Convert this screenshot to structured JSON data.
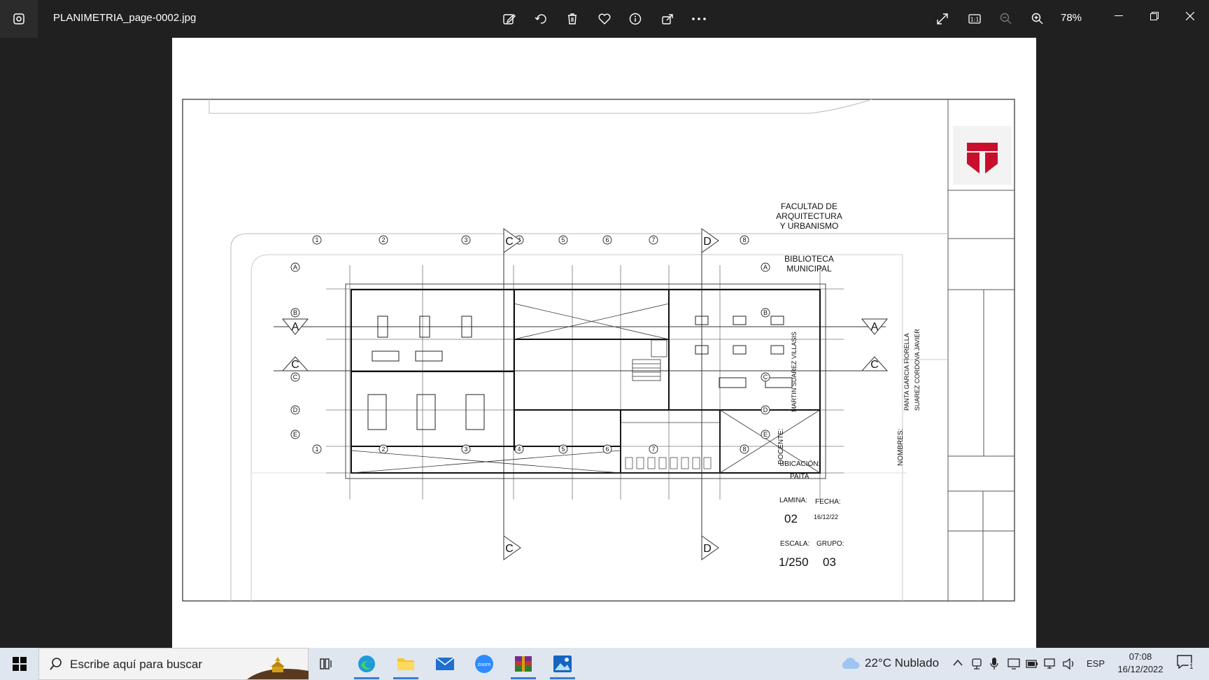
{
  "window": {
    "filename": "PLANIMETRIA_page-0002.jpg",
    "zoom": "78%"
  },
  "toolbar_icons": [
    "edit-icon",
    "rotate-icon",
    "delete-icon",
    "favorite-icon",
    "info-icon",
    "share-icon",
    "more-icon"
  ],
  "right_icons": [
    "fullscreen-icon",
    "actual-size-icon",
    "zoom-out-icon",
    "zoom-in-icon"
  ],
  "drawing": {
    "faculty": "FACULTAD DE\nARQUITECTURA\nY URBANISMO",
    "faculty_lines": [
      "FACULTAD DE",
      "ARQUITECTURA",
      "Y URBANISMO"
    ],
    "project_lines": [
      "BIBLIOTECA",
      "MUNICIPAL"
    ],
    "docente_label": "DOCENTE:",
    "docente_name": "MARTIN SUAREZ VILLASIS",
    "nombres_label": "NOMBRES:",
    "names": [
      "PANTA GARCIA FIORELLA",
      "SUAREZ CORDOVA JAVIER"
    ],
    "ubicacion_label": "UBICACIÓN:",
    "ubicacion": "PAITA",
    "lamina_label": "LAMINA:",
    "lamina": "02",
    "fecha_label": "FECHA:",
    "fecha": "16/12/22",
    "escala_label": "ESCALA:",
    "escala": "1/250",
    "grupo_label": "GRUPO:",
    "grupo": "03",
    "section_marks": [
      "A",
      "C",
      "D"
    ],
    "axis_numbers": [
      "1",
      "2",
      "3",
      "4",
      "5",
      "6",
      "7",
      "8"
    ],
    "axis_letters": [
      "A",
      "B",
      "C",
      "D",
      "E"
    ],
    "brand_color": "#c8102e"
  },
  "taskbar": {
    "search_placeholder": "Escribe aquí para buscar",
    "weather": "22°C  Nublado",
    "language": "ESP",
    "time": "07:08",
    "date": "16/12/2022",
    "notifications": "1"
  }
}
